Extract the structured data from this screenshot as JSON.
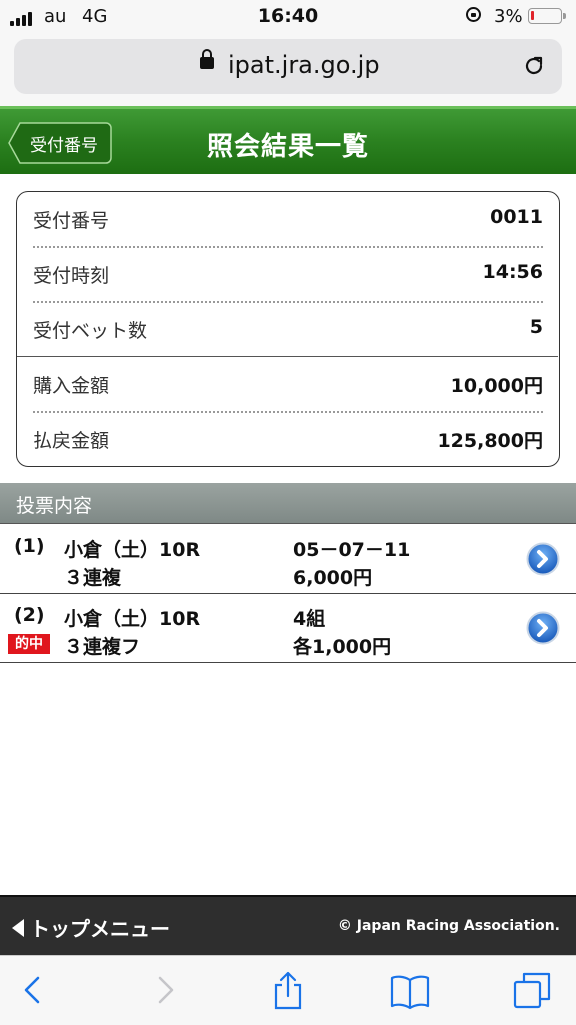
{
  "status_bar": {
    "carrier": "au",
    "network": "4G",
    "time": "16:40",
    "battery_percent": "3%",
    "battery_level": 0.03
  },
  "browser": {
    "url": "ipat.jra.go.jp"
  },
  "header": {
    "back_label": "受付番号",
    "title": "照会結果一覧"
  },
  "summary": {
    "rows": [
      {
        "label": "受付番号",
        "value": "0011"
      },
      {
        "label": "受付時刻",
        "value": "14:56"
      },
      {
        "label": "受付ベット数",
        "value": "5"
      },
      {
        "label": "購入金額",
        "value": "10,000円"
      },
      {
        "label": "払戻金額",
        "value": "125,800円"
      }
    ]
  },
  "bets_section": {
    "title": "投票内容",
    "items": [
      {
        "number": "(1)",
        "race": "小倉（土）10R",
        "bet_type": "３連複",
        "combination": "05－07－11",
        "amount": "6,000円",
        "hit": ""
      },
      {
        "number": "(2)",
        "race": "小倉（土）10R",
        "bet_type": "３連複フ",
        "combination": "4組",
        "amount": "各1,000円",
        "hit": "的中"
      }
    ]
  },
  "footer": {
    "top_menu_label": "トップメニュー",
    "copyright": "© Japan Racing Association."
  },
  "colors": {
    "header_green": "#2b8120",
    "hit_red": "#e0161d",
    "arrow_blue": "#1f6fd1",
    "section_gray": "#8a9491",
    "footer_dark": "#2e2e2e"
  },
  "icons": [
    "signal-icon",
    "screen-rotation-lock-icon",
    "battery-icon",
    "lock-icon",
    "reload-icon",
    "back-arrow-icon",
    "chevron-right-circle-icon",
    "left-triangle-icon",
    "safari-back-icon",
    "safari-forward-icon",
    "share-icon",
    "bookmarks-icon",
    "tabs-icon"
  ]
}
